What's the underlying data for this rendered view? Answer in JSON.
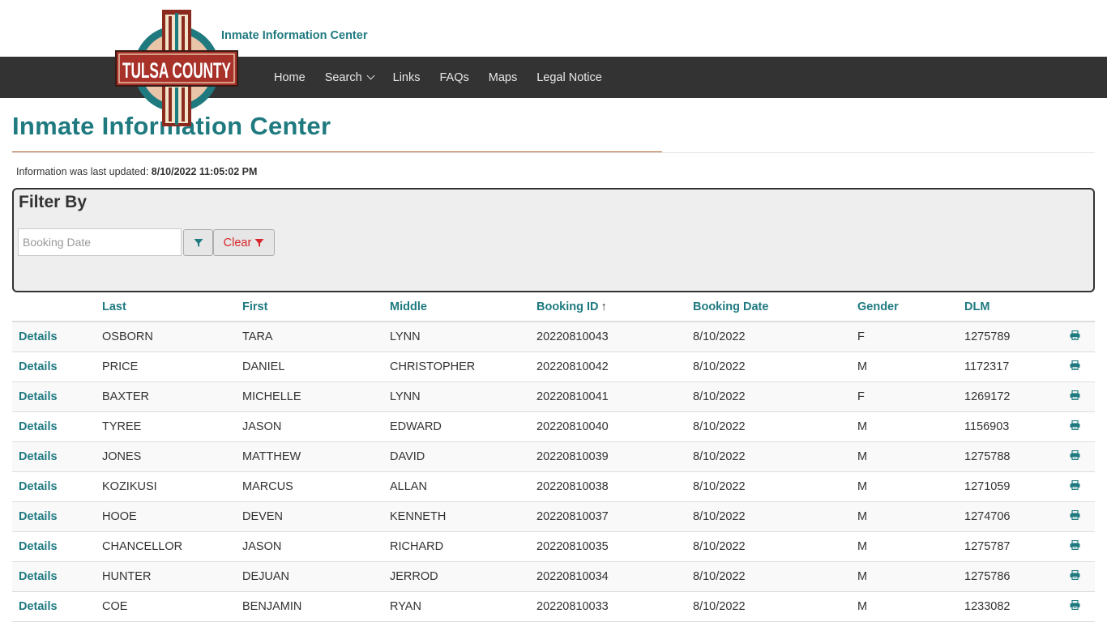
{
  "site": {
    "title": "Inmate Information Center",
    "logo_text": "TULSA COUNTY"
  },
  "nav": {
    "items": [
      "Home",
      "Search",
      "Links",
      "FAQs",
      "Maps",
      "Legal Notice"
    ]
  },
  "page": {
    "title": "Inmate Information Center",
    "updated_label": "Information was last updated:",
    "updated_value": "8/10/2022 11:05:02 PM"
  },
  "filter": {
    "title": "Filter By",
    "date_placeholder": "Booking Date",
    "clear_label": "Clear"
  },
  "table": {
    "headers": [
      "Last",
      "First",
      "Middle",
      "Booking ID",
      "Booking Date",
      "Gender",
      "DLM"
    ],
    "sort_indicator": "↑",
    "details_label": "Details",
    "rows": [
      [
        "OSBORN",
        "TARA",
        "LYNN",
        "20220810043",
        "8/10/2022",
        "F",
        "1275789"
      ],
      [
        "PRICE",
        "DANIEL",
        "CHRISTOPHER",
        "20220810042",
        "8/10/2022",
        "M",
        "1172317"
      ],
      [
        "BAXTER",
        "MICHELLE",
        "LYNN",
        "20220810041",
        "8/10/2022",
        "F",
        "1269172"
      ],
      [
        "TYREE",
        "JASON",
        "EDWARD",
        "20220810040",
        "8/10/2022",
        "M",
        "1156903"
      ],
      [
        "JONES",
        "MATTHEW",
        "DAVID",
        "20220810039",
        "8/10/2022",
        "M",
        "1275788"
      ],
      [
        "KOZIKUSI",
        "MARCUS",
        "ALLAN",
        "20220810038",
        "8/10/2022",
        "M",
        "1271059"
      ],
      [
        "HOOE",
        "DEVEN",
        "KENNETH",
        "20220810037",
        "8/10/2022",
        "M",
        "1274706"
      ],
      [
        "CHANCELLOR",
        "JASON",
        "RICHARD",
        "20220810035",
        "8/10/2022",
        "M",
        "1275787"
      ],
      [
        "HUNTER",
        "DEJUAN",
        "JERROD",
        "20220810034",
        "8/10/2022",
        "M",
        "1275786"
      ],
      [
        "COE",
        "BENJAMIN",
        "RYAN",
        "20220810033",
        "8/10/2022",
        "M",
        "1233082"
      ]
    ]
  },
  "colors": {
    "accent": "#1f7a80",
    "navbar": "#333333",
    "danger": "#d9262b",
    "rule": "#b0622c"
  },
  "icons": {
    "filter": "filter-icon",
    "print": "print-icon"
  }
}
